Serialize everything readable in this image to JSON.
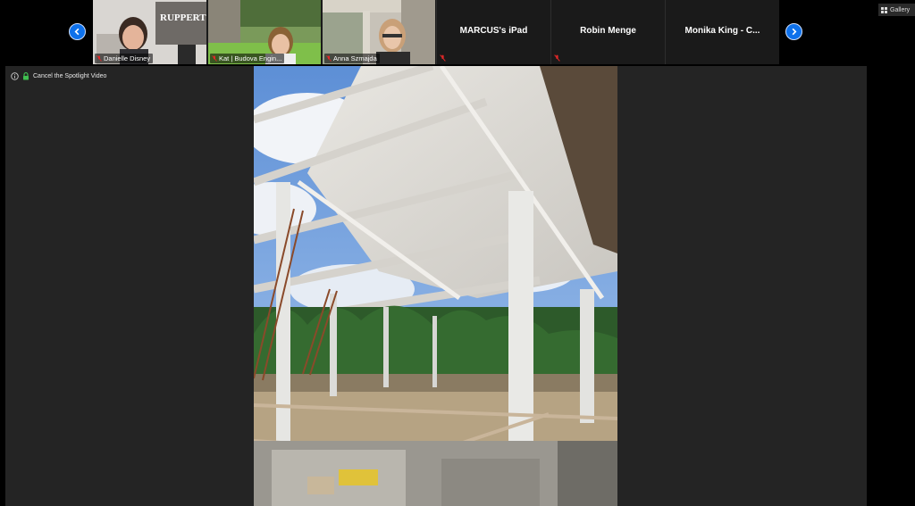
{
  "participants": [
    {
      "type": "video",
      "name": "Danielle Disney",
      "sign": "RUPPERT"
    },
    {
      "type": "video",
      "name": "Kat | Budova Engin..."
    },
    {
      "type": "video",
      "name": "Anna Szmajda"
    },
    {
      "type": "name",
      "name": "MARCUS's iPad"
    },
    {
      "type": "name",
      "name": "Robin Menge"
    },
    {
      "type": "name",
      "name": "Monika King - C..."
    }
  ],
  "gallery_label": "Gallery",
  "spotlight": {
    "cancel_label": "Cancel the Spotlight Video"
  },
  "colors": {
    "accent": "#0e71eb",
    "muted": "#e02828",
    "panel": "#242424",
    "strip": "#1a1a1a"
  },
  "icons": {
    "prev": "chevron-left-icon",
    "next": "chevron-right-icon",
    "gallery": "grid-icon",
    "info": "info-icon",
    "lock": "lock-icon",
    "mic": "mic-muted-icon"
  }
}
